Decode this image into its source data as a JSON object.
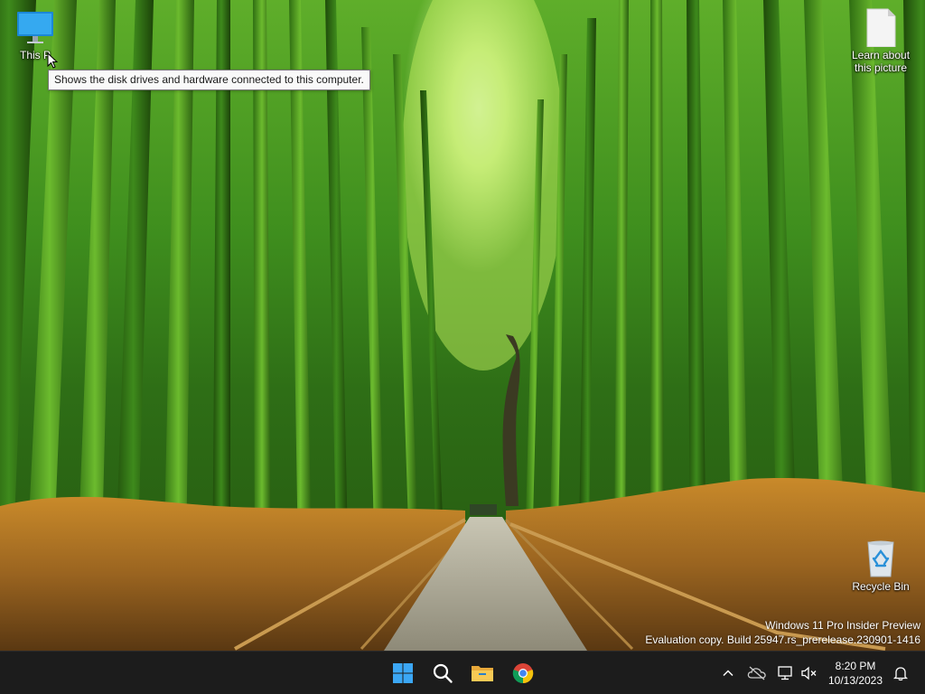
{
  "desktop": {
    "icons": {
      "this_pc": {
        "label": "This PC",
        "label_visible": "This P"
      },
      "learn": {
        "label": "Learn about this picture"
      },
      "recycle_bin": {
        "label": "Recycle Bin"
      }
    },
    "tooltip": "Shows the disk drives and hardware connected to this computer.",
    "watermark": {
      "line1": "Windows 11 Pro Insider Preview",
      "line2": "Evaluation copy. Build 25947.rs_prerelease.230901-1416"
    }
  },
  "taskbar": {
    "apps": [
      "windows-start",
      "search",
      "file-explorer",
      "google-chrome"
    ],
    "tray": {
      "time": "8:20 PM",
      "date": "10/13/2023"
    }
  },
  "colors": {
    "taskbar": "#1c1c1c",
    "accent_start": "#3ba7f5",
    "folder_yellow": "#f2c14e"
  }
}
